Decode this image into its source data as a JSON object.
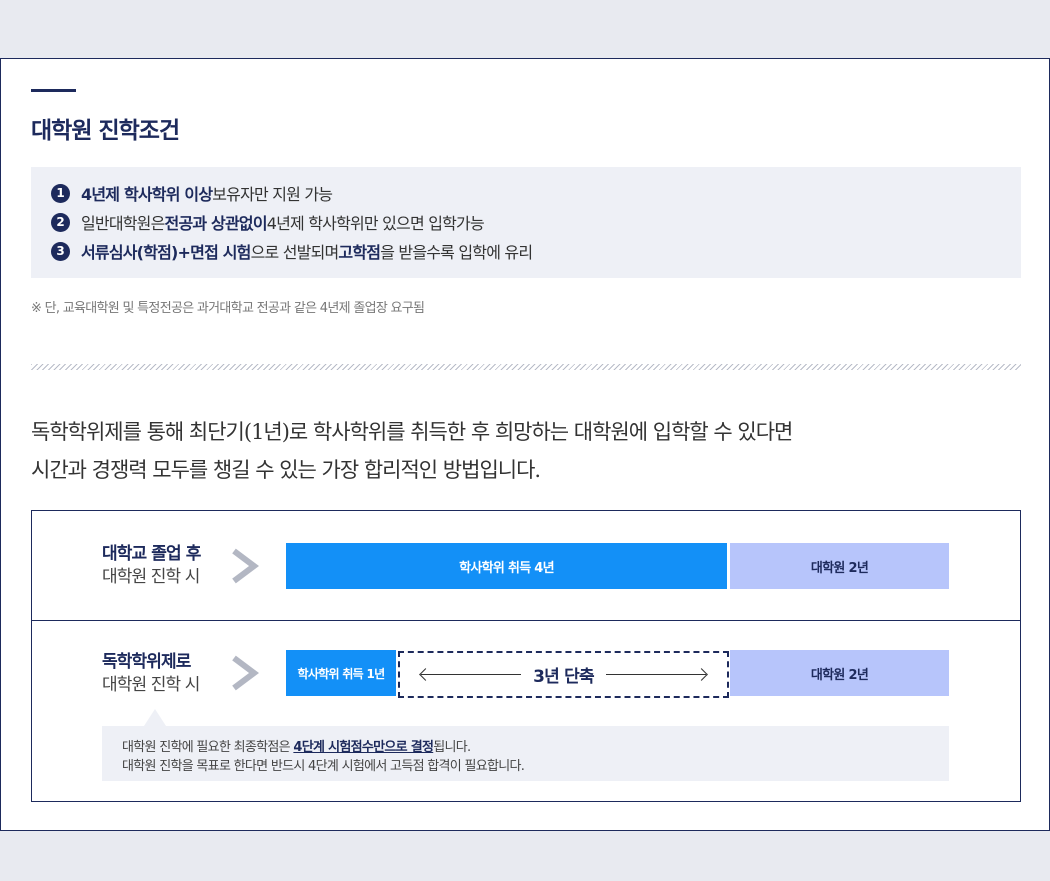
{
  "header": {
    "title": "대학원 진학조건"
  },
  "conditions": [
    {
      "num": "1",
      "parts": [
        {
          "text": "4년제 학사학위 이상",
          "strong": true
        },
        {
          "text": " 보유자만 지원 가능",
          "strong": false
        }
      ]
    },
    {
      "num": "2",
      "parts": [
        {
          "text": "일반대학원은 ",
          "strong": false
        },
        {
          "text": "전공과 상관없이",
          "strong": true
        },
        {
          "text": " 4년제 학사학위만 있으면 입학가능",
          "strong": false
        }
      ]
    },
    {
      "num": "3",
      "parts": [
        {
          "text": "서류심사(학점)+면접 시험",
          "strong": true
        },
        {
          "text": "으로 선발되며 ",
          "strong": false
        },
        {
          "text": "고학점",
          "strong": true
        },
        {
          "text": "을 받을수록 입학에 유리",
          "strong": false
        }
      ]
    }
  ],
  "note": "※ 단, 교육대학원 및 특정전공은 과거대학교 전공과 같은 4년제 졸업장 요구됨",
  "description": {
    "line1": "독학학위제를 통해 최단기(1년)로 학사학위를 취득한 후 희망하는 대학원에 입학할 수 있다면",
    "line2": "시간과 경쟁력 모두를 챙길 수 있는 가장 합리적인 방법입니다."
  },
  "comparison": {
    "row1": {
      "label_main": "대학교 졸업 후",
      "label_sub": "대학원 진학 시",
      "bar_degree": "학사학위 취득 4년",
      "bar_grad": "대학원 2년"
    },
    "row2": {
      "label_main": "독학학위제로",
      "label_sub": "대학원 진학 시",
      "bar_degree": "학사학위 취득 1년",
      "shortened": "3년 단축",
      "bar_grad": "대학원 2년"
    },
    "info": {
      "line1_pre": "대학원 진학에 필요한 최종학점은 ",
      "line1_strong": "4단계 시험점수만으로 결정",
      "line1_post": "됩니다.",
      "line2": "대학원 진학을 목표로 한다면 반드시 4단계 시험에서 고득점 합격이 필요합니다."
    }
  },
  "colors": {
    "navy": "#1d2a5c",
    "blue": "#1390f7",
    "light_blue": "#b7c5fb",
    "panel": "#eef0f6"
  }
}
